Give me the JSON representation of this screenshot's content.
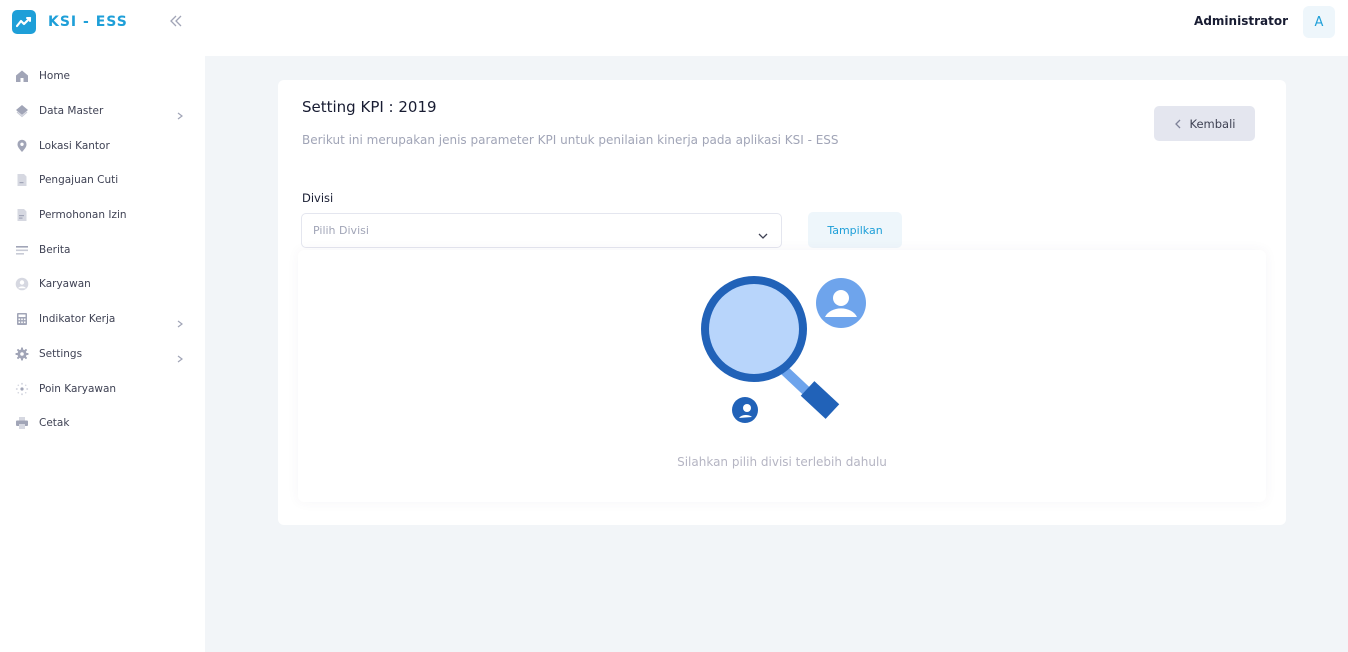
{
  "app": {
    "brand_name": "KSI - ESS",
    "brand_color": "#1e9fd8"
  },
  "sidebar": {
    "items": [
      {
        "label": "Home",
        "icon": "home-icon",
        "has_submenu": false
      },
      {
        "label": "Data Master",
        "icon": "layers-icon",
        "has_submenu": true
      },
      {
        "label": "Lokasi Kantor",
        "icon": "map-pin-icon",
        "has_submenu": false
      },
      {
        "label": "Pengajuan Cuti",
        "icon": "file-icon",
        "has_submenu": false
      },
      {
        "label": "Permohonan Izin",
        "icon": "document-icon",
        "has_submenu": false
      },
      {
        "label": "Berita",
        "icon": "news-icon",
        "has_submenu": false
      },
      {
        "label": "Karyawan",
        "icon": "user-circle-icon",
        "has_submenu": false
      },
      {
        "label": "Indikator Kerja",
        "icon": "calculator-icon",
        "has_submenu": true
      },
      {
        "label": "Settings",
        "icon": "gear-icon",
        "has_submenu": true
      },
      {
        "label": "Poin Karyawan",
        "icon": "sparkle-icon",
        "has_submenu": false
      },
      {
        "label": "Cetak",
        "icon": "printer-icon",
        "has_submenu": false
      }
    ]
  },
  "header": {
    "user_name": "Administrator",
    "avatar_initial": "A"
  },
  "main": {
    "title": "Setting KPI : 2019",
    "subtitle": "Berikut ini merupakan jenis parameter KPI untuk penilaian kinerja pada aplikasi KSI - ESS",
    "back_button_label": "Kembali",
    "division_label": "Divisi",
    "division_placeholder": "Pilih Divisi",
    "show_button_label": "Tampilkan",
    "empty_state_text": "Silahkan pilih divisi terlebih dahulu"
  },
  "colors": {
    "accent": "#1e9fd8",
    "illustration_dark": "#2162b8",
    "illustration_light": "#b8d5fb"
  }
}
